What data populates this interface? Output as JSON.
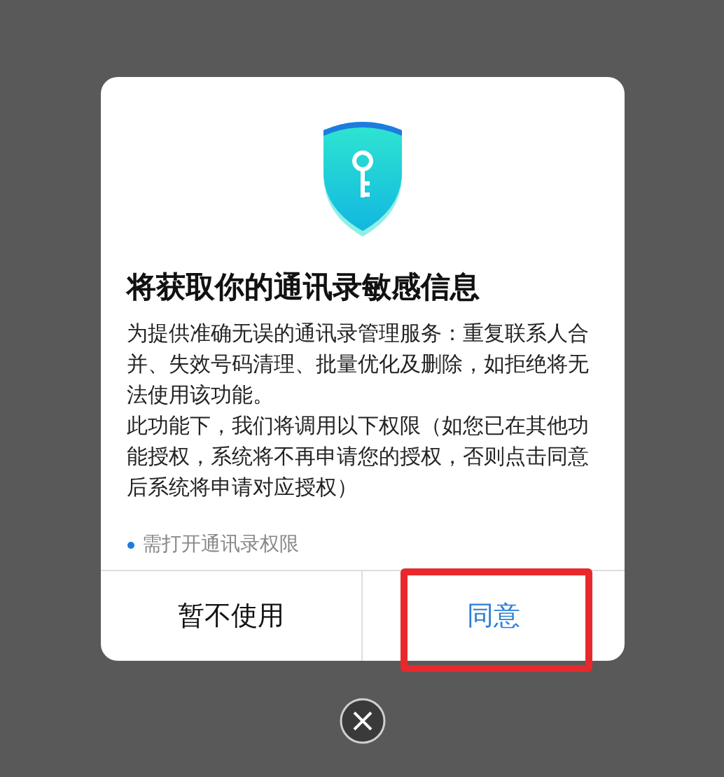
{
  "dialog": {
    "title": "将获取你的通讯录敏感信息",
    "paragraphs": [
      "为提供准确无误的通讯录管理服务：重复联系人合并、失效号码清理、批量优化及删除，如拒绝将无法使用该功能。",
      "此功能下，我们将调用以下权限（如您已在其他功能授权，系统将不再申请您的授权，否则点击同意后系统将申请对应授权）"
    ],
    "note": "需打开通讯录权限",
    "buttons": [
      {
        "label": "暂不使用",
        "kind": "secondary",
        "highlighted": false
      },
      {
        "label": "同意",
        "kind": "primary",
        "highlighted": true
      }
    ]
  }
}
